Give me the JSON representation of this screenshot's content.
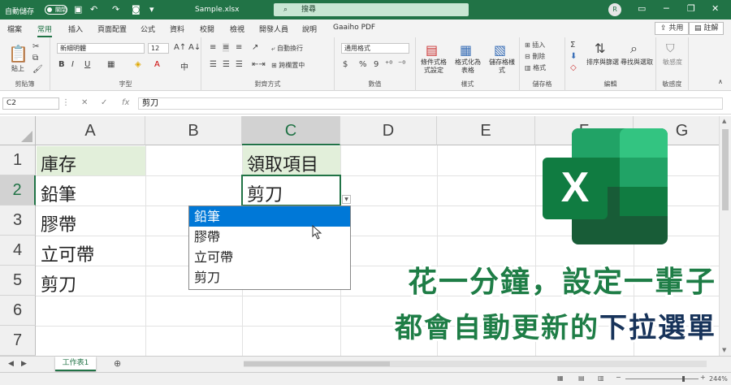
{
  "titlebar": {
    "autosave_label": "自動儲存",
    "autosave_state": "關閉",
    "filename": "Sample.xlsx",
    "search_placeholder": "搜尋",
    "user_initial": "R"
  },
  "ribbon_tabs": [
    "檔案",
    "常用",
    "插入",
    "頁面配置",
    "公式",
    "資料",
    "校閱",
    "檢視",
    "開發人員",
    "說明",
    "Gaaiho PDF"
  ],
  "share_label": "共用",
  "comments_label": "註解",
  "ribbon": {
    "clipboard": {
      "label": "剪貼簿",
      "paste": "貼上"
    },
    "font": {
      "label": "字型",
      "font_name": "新細明體",
      "font_size": "12",
      "bold": "B",
      "italic": "I",
      "underline": "U"
    },
    "alignment": {
      "label": "對齊方式",
      "wrap": "自動換行",
      "merge": "跨欄置中"
    },
    "number": {
      "label": "數值",
      "format": "通用格式",
      "percent": "%",
      "comma": "9"
    },
    "styles": {
      "label": "樣式",
      "conditional": "條件式格式設定",
      "table": "格式化為表格",
      "cell_styles": "儲存格樣式"
    },
    "cells": {
      "label": "儲存格",
      "insert": "插入",
      "delete": "刪除",
      "format": "格式"
    },
    "editing": {
      "label": "編輯",
      "sort": "排序與篩選",
      "find": "尋找與選取"
    },
    "sensitivity": {
      "label": "敏感度",
      "btn": "敏感度"
    }
  },
  "formula_bar": {
    "name_box": "C2",
    "fx": "fx",
    "value": "剪刀"
  },
  "columns": [
    "A",
    "B",
    "C",
    "D",
    "E",
    "F",
    "G"
  ],
  "rows": [
    "1",
    "2",
    "3",
    "4",
    "5",
    "6",
    "7"
  ],
  "cells": {
    "A1": "庫存",
    "A2": "鉛筆",
    "A3": "膠帶",
    "A4": "立可帶",
    "A5": "剪刀",
    "C1": "領取項目",
    "C2": "剪刀"
  },
  "dropdown_items": [
    "鉛筆",
    "膠帶",
    "立可帶",
    "剪刀"
  ],
  "dropdown_selected_index": 0,
  "sheet_tab": "工作表1",
  "zoom": "244%",
  "overlay": {
    "logo_letter": "X",
    "headline_line1": "花一分鐘，設定一輩子",
    "headline_line2_a": "都會自動更新的",
    "headline_line2_b": "下拉選單"
  },
  "colors": {
    "excel_green": "#217346",
    "selected_item": "#0078d7",
    "header_highlight": "#e2efda"
  }
}
